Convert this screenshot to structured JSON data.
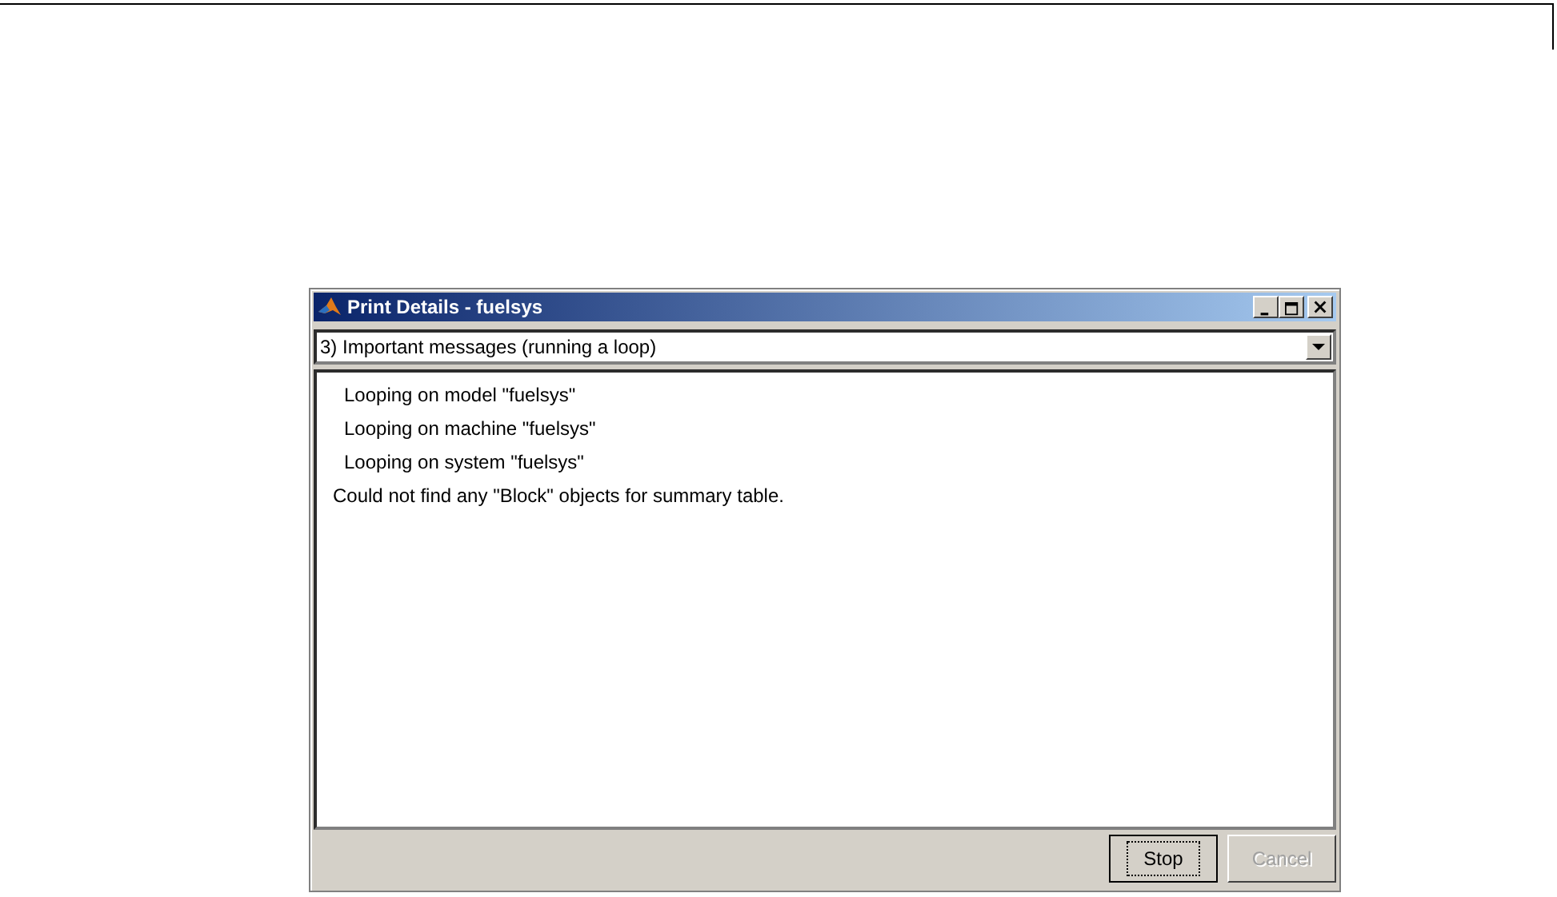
{
  "window": {
    "title": "Print Details - fuelsys"
  },
  "level_select": {
    "value": "3) Important messages (running a loop)"
  },
  "messages": [
    {
      "text": "Looping on model \"fuelsys\"",
      "kind": "step"
    },
    {
      "text": "Looping on machine \"fuelsys\"",
      "kind": "step"
    },
    {
      "text": "Looping on system \"fuelsys\"",
      "kind": "step"
    },
    {
      "text": "Could not find any \"Block\" objects for summary table.",
      "kind": "note"
    }
  ],
  "buttons": [
    {
      "label": "Stop",
      "disabled": false,
      "focused": true
    },
    {
      "label": "Cancel",
      "disabled": true,
      "focused": false
    }
  ]
}
